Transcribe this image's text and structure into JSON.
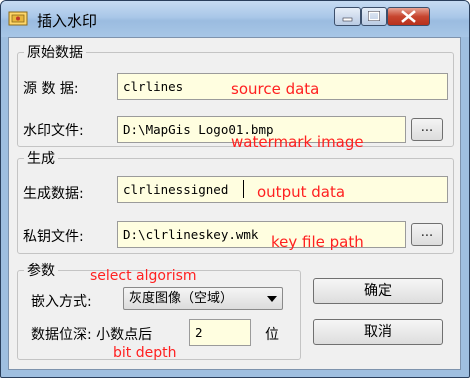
{
  "window": {
    "title": "插入水印",
    "controls": [
      "minimize",
      "maximize",
      "close"
    ],
    "icon": "stamp-app-icon"
  },
  "group_source": {
    "title": "原始数据",
    "source_label": "源 数 据:",
    "source_value": "clrlines",
    "source_annotation": "source data",
    "watermark_label": "水印文件:",
    "watermark_value": "D:\\MapGis Logo01.bmp",
    "watermark_annotation": "watermark image",
    "browse_label": "..."
  },
  "group_generate": {
    "title": "生成",
    "output_label": "生成数据:",
    "output_value": "clrlinessigned",
    "output_annotation": "output data",
    "key_label": "私钥文件:",
    "key_value": "D:\\clrlineskey.wmk",
    "key_annotation": "key file path",
    "browse_label": "..."
  },
  "group_params": {
    "title": "参数",
    "algorithm_annotation": "select algorism",
    "embed_label": "嵌入方式:",
    "embed_selected": "灰度图像（空域）",
    "depth_label": "数据位深: 小数点后",
    "depth_value": "2",
    "depth_unit": "位",
    "depth_annotation": "bit depth"
  },
  "buttons": {
    "ok": "确定",
    "cancel": "取消"
  },
  "colors": {
    "input_background": "#fffee0",
    "annotation": "#ff2020",
    "close_button": "#c7452f",
    "title_bar": "#a9c7e8"
  }
}
